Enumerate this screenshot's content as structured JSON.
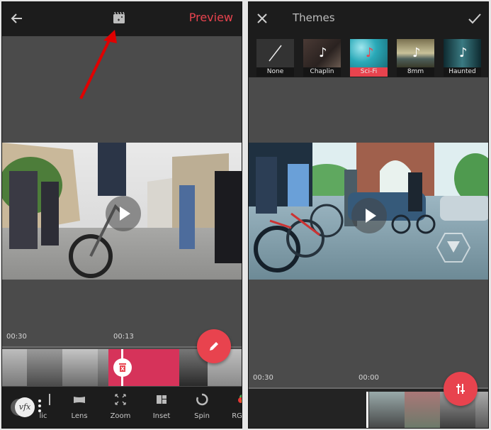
{
  "left_screen": {
    "topbar": {
      "back_icon": "arrow-left-icon",
      "center_icon": "clapperboard-sparkle-icon",
      "preview_label": "Preview"
    },
    "timeline": {
      "time_left": "00:30",
      "time_center": "00:13"
    },
    "fab_icon": "pencil-icon",
    "toolbar": {
      "vfx_label": "vfx",
      "items": [
        {
          "label": "lic",
          "icon": "partial-icon"
        },
        {
          "label": "Lens",
          "icon": "lens-icon"
        },
        {
          "label": "Zoom",
          "icon": "zoom-expand-icon"
        },
        {
          "label": "Inset",
          "icon": "inset-icon"
        },
        {
          "label": "Spin",
          "icon": "spin-icon"
        },
        {
          "label": "RGB",
          "icon": "rgb-icon"
        }
      ]
    }
  },
  "right_screen": {
    "topbar": {
      "close_icon": "close-icon",
      "title": "Themes",
      "confirm_icon": "check-icon"
    },
    "themes": [
      {
        "label": "None",
        "selected": false
      },
      {
        "label": "Chaplin",
        "selected": false
      },
      {
        "label": "Sci-Fi",
        "selected": true
      },
      {
        "label": "8mm",
        "selected": false
      },
      {
        "label": "Haunted",
        "selected": false
      }
    ],
    "timeline": {
      "time_left": "00:30",
      "time_center": "00:00"
    },
    "fab_icon": "sliders-icon"
  },
  "colors": {
    "accent": "#e8434e",
    "bar_bg": "#1c1c1c",
    "panel_bg": "#4b4b4b",
    "annotation_arrow": "#e00000"
  }
}
